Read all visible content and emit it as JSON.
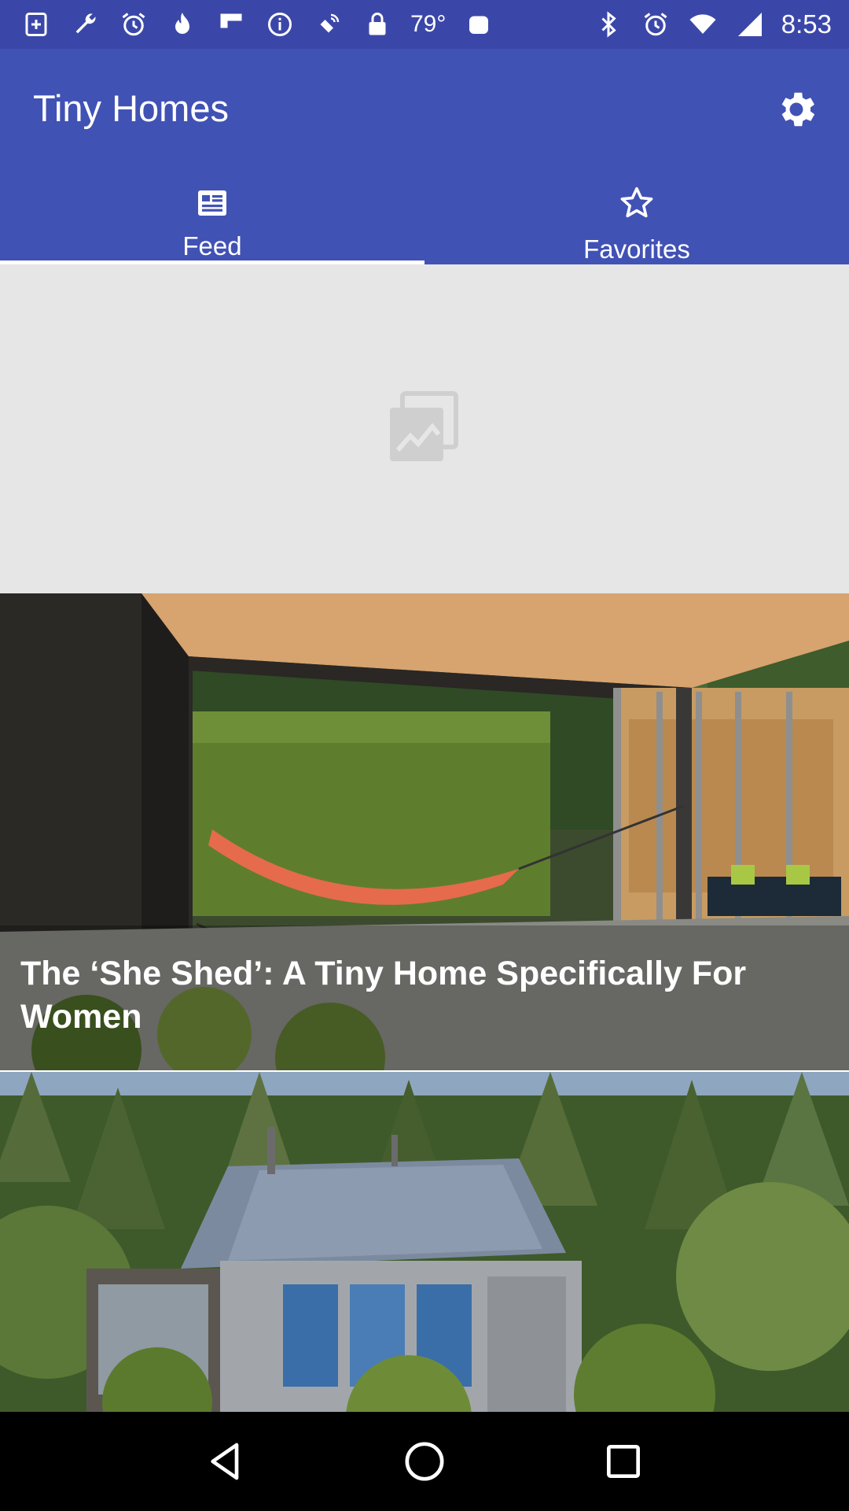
{
  "status_bar": {
    "temperature": "79°",
    "time": "8:53",
    "left_icons": [
      "medical-app-icon",
      "wrench-icon",
      "alarm-icon",
      "flame-icon",
      "flipboard-icon",
      "info-icon",
      "satellite-icon",
      "lock-icon"
    ],
    "right_icons": [
      "bluetooth-icon",
      "alarm-icon",
      "wifi-icon",
      "signal-icon"
    ]
  },
  "app_bar": {
    "title": "Tiny Homes",
    "settings_icon": "gear-icon"
  },
  "tabs": [
    {
      "label": "Feed",
      "icon": "newspaper-icon",
      "active": true
    },
    {
      "label": "Favorites",
      "icon": "star-outline-icon",
      "active": false
    }
  ],
  "feed": {
    "items": [
      {
        "type": "image-placeholder",
        "icon": "image-placeholder-icon"
      },
      {
        "type": "article",
        "title": "The ‘She Shed’: A Tiny Home Specifically For Women"
      },
      {
        "type": "article",
        "title": ""
      }
    ]
  },
  "nav_bar": {
    "buttons": [
      "back-icon",
      "home-icon",
      "recents-icon"
    ]
  },
  "colors": {
    "status_bar": "#3b47a8",
    "app_bar": "#4152b5",
    "placeholder_bg": "#e6e6e6"
  }
}
